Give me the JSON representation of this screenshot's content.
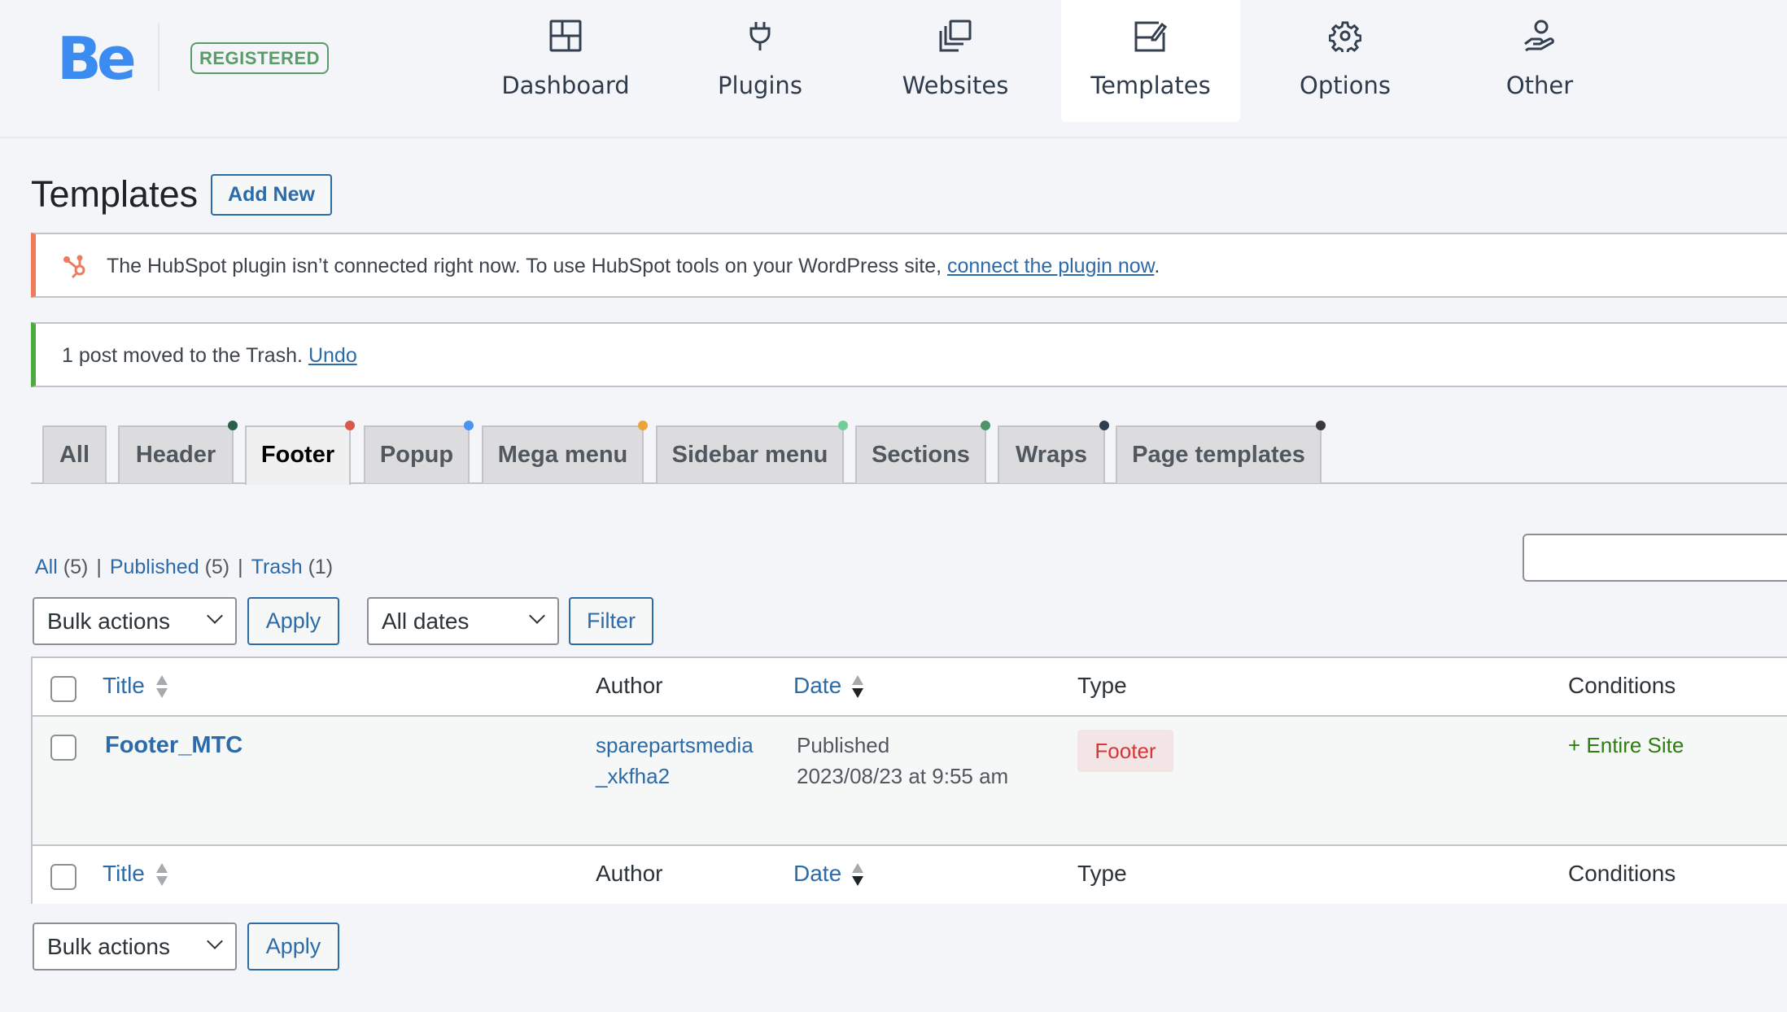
{
  "logo": {
    "text": "Be",
    "badge": "REGISTERED"
  },
  "nav": {
    "items": [
      {
        "label": "Dashboard",
        "icon": "dashboard-grid-icon",
        "active": false
      },
      {
        "label": "Plugins",
        "icon": "plug-icon",
        "active": false
      },
      {
        "label": "Websites",
        "icon": "copy-stack-icon",
        "active": false
      },
      {
        "label": "Templates",
        "icon": "edit-template-icon",
        "active": true
      },
      {
        "label": "Options",
        "icon": "gear-icon",
        "active": false
      },
      {
        "label": "Other",
        "icon": "hand-user-icon",
        "active": false
      }
    ]
  },
  "page": {
    "title": "Templates",
    "add_new_label": "Add New"
  },
  "notices": {
    "hubspot": {
      "icon": "hubspot-icon",
      "text": "The HubSpot plugin isn’t connected right now. To use HubSpot tools on your WordPress site, ",
      "link": "connect the plugin now",
      "suffix": ".",
      "accent": "#ee7c5c"
    },
    "trash": {
      "text": "1 post moved to the Trash. ",
      "link": "Undo",
      "accent": "#4caa3f"
    }
  },
  "tabs": [
    {
      "label": "All",
      "dot": null,
      "active": false
    },
    {
      "label": "Header",
      "dot": "#2a6049",
      "active": false
    },
    {
      "label": "Footer",
      "dot": "#d9584a",
      "active": true
    },
    {
      "label": "Popup",
      "dot": "#4b93f0",
      "active": false
    },
    {
      "label": "Mega menu",
      "dot": "#eaa43a",
      "active": false
    },
    {
      "label": "Sidebar menu",
      "dot": "#6fcf97",
      "active": false
    },
    {
      "label": "Sections",
      "dot": "#4d9466",
      "active": false
    },
    {
      "label": "Wraps",
      "dot": "#2c3e50",
      "active": false
    },
    {
      "label": "Page templates",
      "dot": "#3a3a3a",
      "active": false
    }
  ],
  "status_links": [
    {
      "label": "All",
      "count": "(5)"
    },
    {
      "label": "Published",
      "count": "(5)"
    },
    {
      "label": "Trash",
      "count": "(1)"
    }
  ],
  "filters": {
    "bulk_actions": "Bulk actions",
    "apply": "Apply",
    "dates": "All dates",
    "filter": "Filter",
    "search_value": ""
  },
  "table": {
    "columns": {
      "title": "Title",
      "author": "Author",
      "date": "Date",
      "type": "Type",
      "conditions": "Conditions"
    },
    "rows": [
      {
        "title": "Footer_MTC",
        "author_line1": "sparepartsmedia",
        "author_line2": "_xkfha2",
        "status": "Published",
        "date": "2023/08/23 at 9:55 am",
        "type": "Footer",
        "conditions": "+ Entire Site"
      }
    ]
  },
  "bottom": {
    "bulk_actions": "Bulk actions",
    "apply": "Apply"
  }
}
